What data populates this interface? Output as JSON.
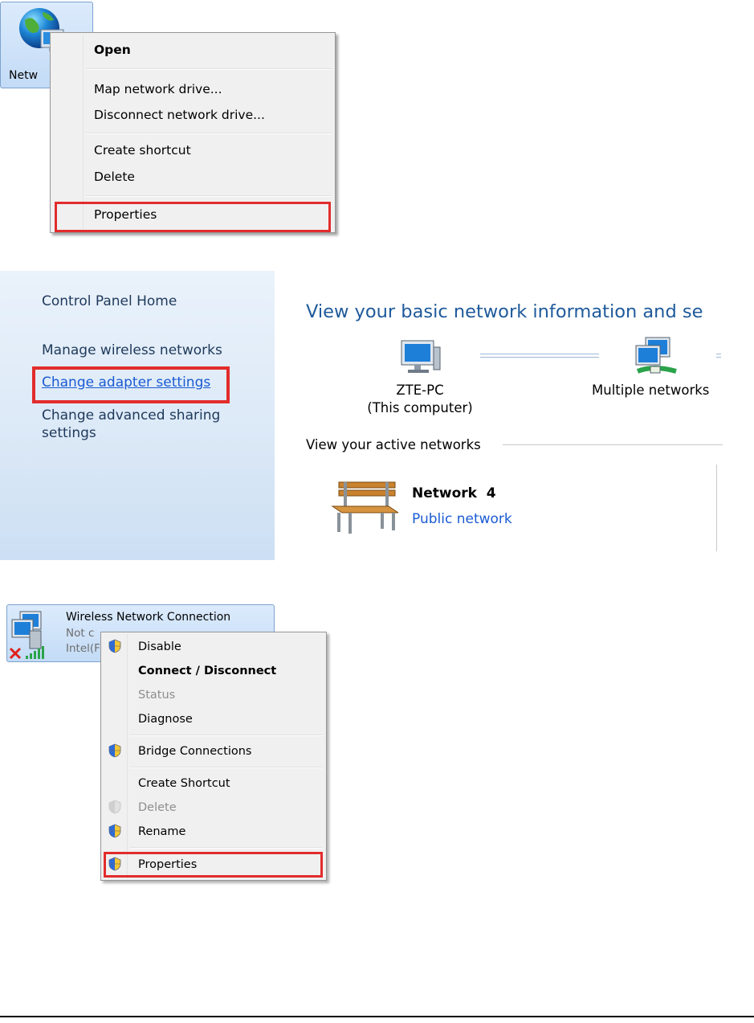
{
  "desktop": {
    "network_icon_label": "Netw"
  },
  "context_menu_1": {
    "items": [
      {
        "label": "Open",
        "bold": true
      },
      {
        "label": "Map network drive..."
      },
      {
        "label": "Disconnect network drive..."
      },
      {
        "label": "Create shortcut"
      },
      {
        "label": "Delete"
      },
      {
        "label": "Properties",
        "highlighted": true
      }
    ]
  },
  "control_panel": {
    "sidebar": {
      "home": "Control Panel Home",
      "links": [
        "Manage wireless networks",
        "Change adapter settings",
        "Change advanced sharing",
        "settings"
      ],
      "highlighted_link": "Change adapter settings"
    },
    "main": {
      "title": "View your basic network information and se",
      "computer_name": "ZTE-PC",
      "computer_sub": "(This computer)",
      "network_node": "Multiple networks",
      "active_networks_header": "View your active networks",
      "network_name": "Network  4",
      "network_type": "Public network"
    }
  },
  "adapter": {
    "name": "Wireless Network Connection",
    "status_partial": "Not c",
    "device_partial": "Intel(F"
  },
  "context_menu_2": {
    "items": [
      {
        "label": "Disable",
        "shield": true
      },
      {
        "label": "Connect / Disconnect",
        "bold": true
      },
      {
        "label": "Status",
        "disabled": true
      },
      {
        "label": "Diagnose"
      },
      {
        "label": "Bridge Connections",
        "shield": true
      },
      {
        "label": "Create Shortcut"
      },
      {
        "label": "Delete",
        "disabled": true,
        "shield": true
      },
      {
        "label": "Rename",
        "shield": true
      },
      {
        "label": "Properties",
        "shield": true,
        "highlighted": true
      }
    ]
  },
  "colors": {
    "highlight_box": "#e22c2c",
    "link_blue": "#1a5bd3",
    "title_blue": "#1e5a9b",
    "menu_bg": "#f0f0f0"
  }
}
